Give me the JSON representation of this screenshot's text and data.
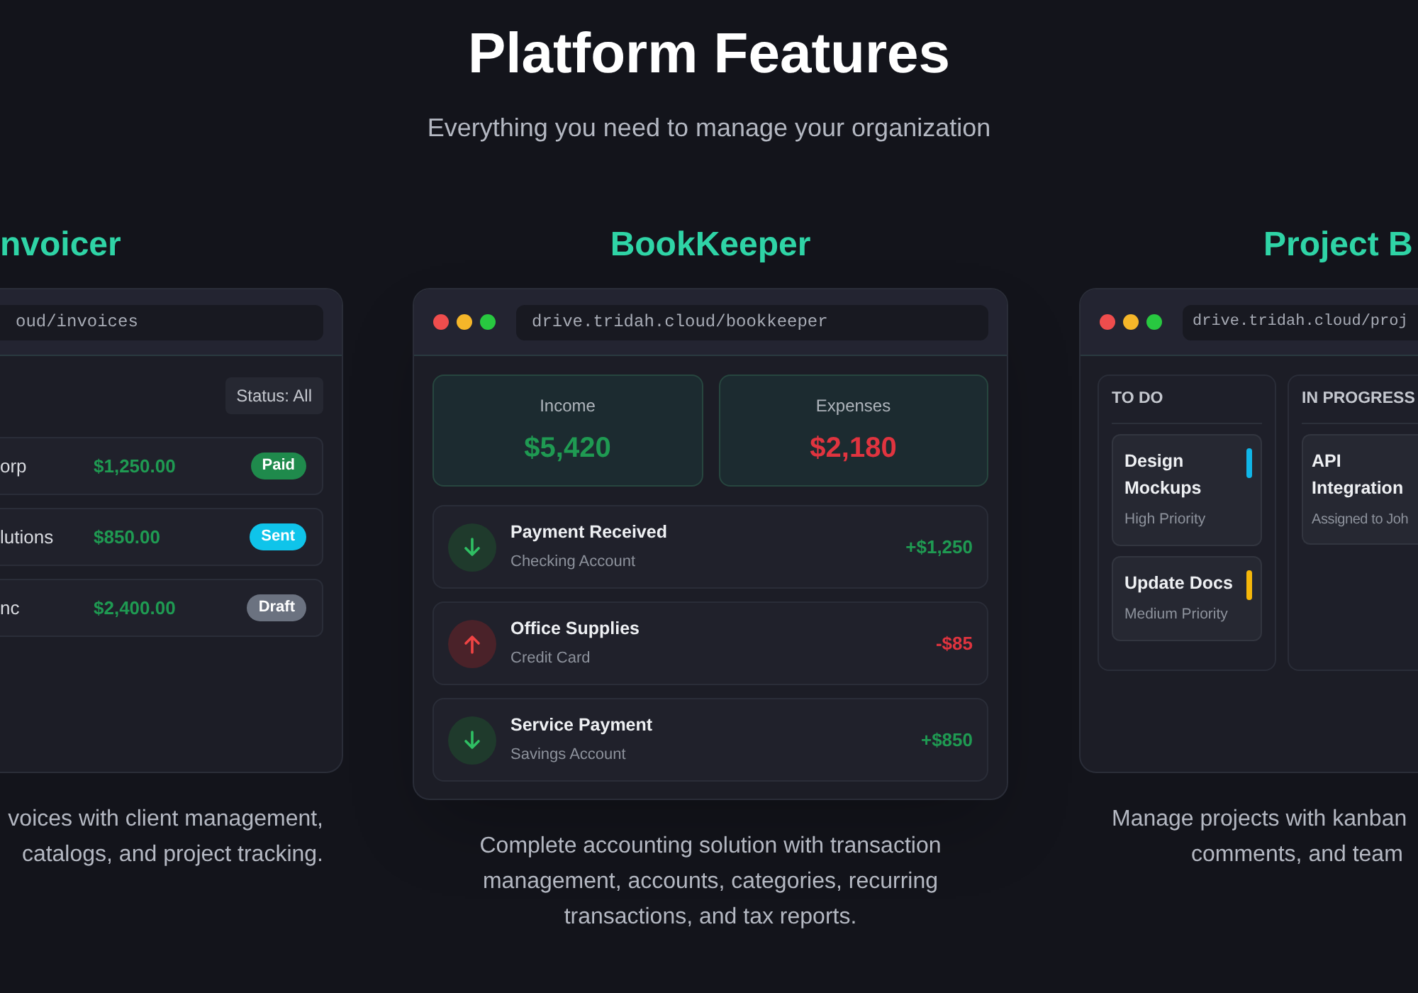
{
  "header": {
    "title": "Platform Features",
    "subtitle": "Everything you need to manage your organization"
  },
  "features": [
    {
      "kind": "invoices",
      "title": "nvoicer",
      "url": "oud/invoices",
      "filter": "Status: All",
      "invoices": [
        {
          "client": "orp",
          "amount": "$1,250.00",
          "status": "Paid",
          "color": "#1f8a4c"
        },
        {
          "client": "lutions",
          "amount": "$850.00",
          "status": "Sent",
          "color": "#0fc4ea"
        },
        {
          "client": "nc",
          "amount": "$2,400.00",
          "status": "Draft",
          "color": "#6b7280"
        }
      ],
      "description": [
        "voices with client management,",
        "catalogs, and project tracking."
      ]
    },
    {
      "kind": "ledger",
      "title": "BookKeeper",
      "url": "drive.tridah.cloud/bookkeeper",
      "stats": [
        {
          "kind": "income",
          "label": "Income",
          "value": "$5,420"
        },
        {
          "kind": "expense",
          "label": "Expenses",
          "value": "$2,180"
        }
      ],
      "transactions": [
        {
          "kind": "in",
          "title": "Payment Received",
          "account": "Checking Account",
          "amount": "+$1,250"
        },
        {
          "kind": "out",
          "title": "Office Supplies",
          "account": "Credit Card",
          "amount": "-$85"
        },
        {
          "kind": "in",
          "title": "Service Payment",
          "account": "Savings Account",
          "amount": "+$850"
        }
      ],
      "description": [
        "Complete accounting solution with transaction management, accounts, categories, recurring transactions, and tax reports."
      ]
    },
    {
      "kind": "kanban",
      "title": "Project B",
      "url": "drive.tridah.cloud/proj",
      "columns": [
        {
          "title": "TO DO",
          "cards": [
            {
              "title": "Design Mockups",
              "note": "High Priority",
              "color": "#10b6e8"
            },
            {
              "title": "Update Docs",
              "note": "Medium Priority",
              "color": "#f5b70a"
            }
          ]
        },
        {
          "title": "IN PROGRESS",
          "cards": [
            {
              "title": "API Integration",
              "note": "Assigned to Joh"
            }
          ]
        }
      ],
      "description": [
        "Manage projects with kanban",
        "comments, and team"
      ]
    }
  ]
}
